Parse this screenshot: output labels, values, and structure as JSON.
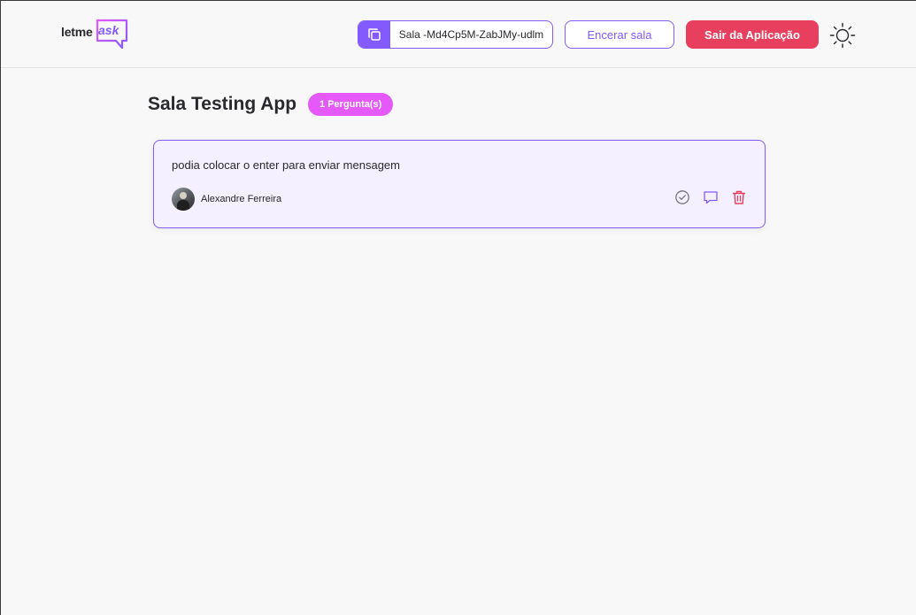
{
  "header": {
    "room_code_label": "Sala -Md4Cp5M-ZabJMy-udlm",
    "end_room_label": "Encerar sala",
    "exit_label": "Sair da Aplicação",
    "logo": {
      "text_primary": "letme",
      "text_accent": "ask"
    }
  },
  "room": {
    "title": "Sala Testing App",
    "question_count_label": "1 Pergunta(s)"
  },
  "questions": [
    {
      "content": "podia colocar o enter para enviar mensagem",
      "author": "Alexandre Ferreira",
      "actions": [
        "check-circle-icon",
        "chat-bubble-icon",
        "trash-icon"
      ]
    }
  ],
  "colors": {
    "accent": "#835afd",
    "danger": "#e73f5d",
    "badge": "#e559f9",
    "card_bg": "#f4f0ff",
    "background": "#f8f8f8"
  }
}
